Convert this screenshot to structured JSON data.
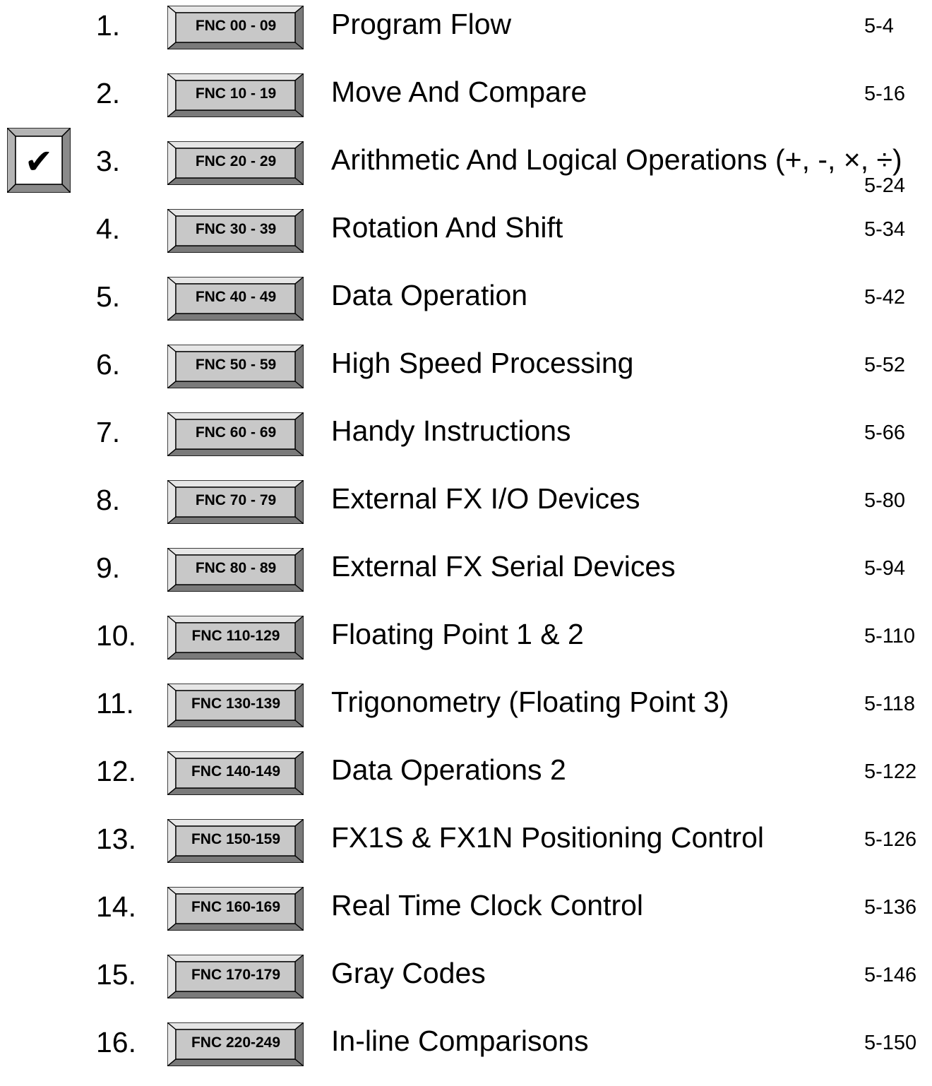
{
  "checkmark": {
    "icon": "check-mark-icon",
    "glyph": "✔"
  },
  "entries": [
    {
      "number": "1.",
      "code": "FNC 00 - 09",
      "title": "Program Flow",
      "page": "5-4"
    },
    {
      "number": "2.",
      "code": "FNC 10 - 19",
      "title": "Move And Compare",
      "page": "5-16"
    },
    {
      "number": "3.",
      "code": "FNC 20 - 29",
      "title": "Arithmetic And Logical Operations (+, -, ×, ÷)",
      "page": "5-24"
    },
    {
      "number": "4.",
      "code": "FNC 30 - 39",
      "title": "Rotation And Shift",
      "page": "5-34"
    },
    {
      "number": "5.",
      "code": "FNC 40 - 49",
      "title": "Data Operation",
      "page": "5-42"
    },
    {
      "number": "6.",
      "code": "FNC 50 - 59",
      "title": "High Speed Processing",
      "page": "5-52"
    },
    {
      "number": "7.",
      "code": "FNC 60 - 69",
      "title": "Handy Instructions",
      "page": "5-66"
    },
    {
      "number": "8.",
      "code": "FNC 70 - 79",
      "title": "External FX I/O Devices",
      "page": "5-80"
    },
    {
      "number": "9.",
      "code": "FNC 80 - 89",
      "title": "External FX Serial Devices",
      "page": "5-94"
    },
    {
      "number": "10.",
      "code": "FNC 110-129",
      "title": "Floating Point 1 & 2",
      "page": "5-110"
    },
    {
      "number": "11.",
      "code": "FNC 130-139",
      "title": "Trigonometry (Floating Point 3)",
      "page": "5-118"
    },
    {
      "number": "12.",
      "code": "FNC 140-149",
      "title": "Data Operations 2",
      "page": "5-122"
    },
    {
      "number": "13.",
      "code": "FNC 150-159",
      "title": "FX1S & FX1N Positioning Control",
      "page": "5-126"
    },
    {
      "number": "14.",
      "code": "FNC 160-169",
      "title": "Real Time Clock Control",
      "page": "5-136"
    },
    {
      "number": "15.",
      "code": "FNC 170-179",
      "title": "Gray Codes",
      "page": "5-146"
    },
    {
      "number": "16.",
      "code": "FNC 220-249",
      "title": "In-line Comparisons",
      "page": "5-150"
    }
  ],
  "colors": {
    "badge_face": "#c8c8c8",
    "badge_light": "#e6e6e6",
    "badge_dark": "#7a7a7a",
    "text": "#000000"
  }
}
